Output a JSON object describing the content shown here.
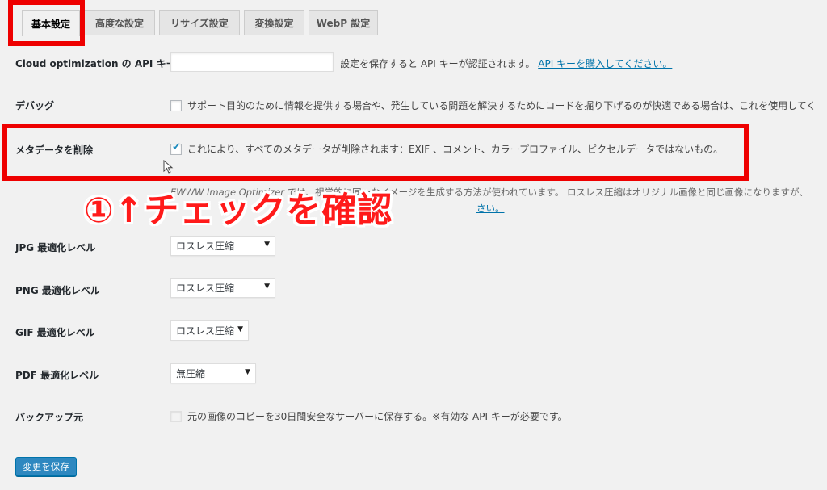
{
  "tabs": [
    "基本設定",
    "高度な設定",
    "リサイズ設定",
    "変換設定",
    "WebP 設定"
  ],
  "api_key": {
    "label": "Cloud optimization の API キー",
    "value": "",
    "note": "設定を保存すると API キーが認証されます。",
    "link": "API キーを購入してください。"
  },
  "debug": {
    "label": "デバッグ",
    "checked": false,
    "text": "サポート目的のために情報を提供する場合や、発生している問題を解決するためにコードを掘り下げるのが快適である場合は、これを使用してく"
  },
  "metadata": {
    "label": "メタデータを削除",
    "checked": true,
    "text": "これにより、すべてのメタデータが削除されます：EXIF 、コメント、カラープロファイル、ピクセルデータではないもの。"
  },
  "lossless_note": {
    "prefix": "EWWW Image Optimizer",
    "text": " では、視覚的に同一なイメージを生成する方法が使われています。 ロスレス圧縮はオリジナル画像と同じ画像になりますが、",
    "link": "さい。"
  },
  "levels": [
    {
      "label": "JPG 最適化レベル",
      "value": "ロスレス圧縮"
    },
    {
      "label": "PNG 最適化レベル",
      "value": "ロスレス圧縮"
    },
    {
      "label": "GIF 最適化レベル",
      "value": "ロスレス圧縮"
    },
    {
      "label": "PDF 最適化レベル",
      "value": "無圧縮"
    }
  ],
  "backup": {
    "label": "バックアップ元",
    "checked": false,
    "text": "元の画像のコピーを30日間安全なサーバーに保存する。※有効な API キーが必要です。"
  },
  "save_button": "変更を保存",
  "annotation": "①↑チェックを確認",
  "colors": {
    "annotation_red": "#ee0000",
    "primary_button": "#2e88c0",
    "link": "#0073aa"
  }
}
